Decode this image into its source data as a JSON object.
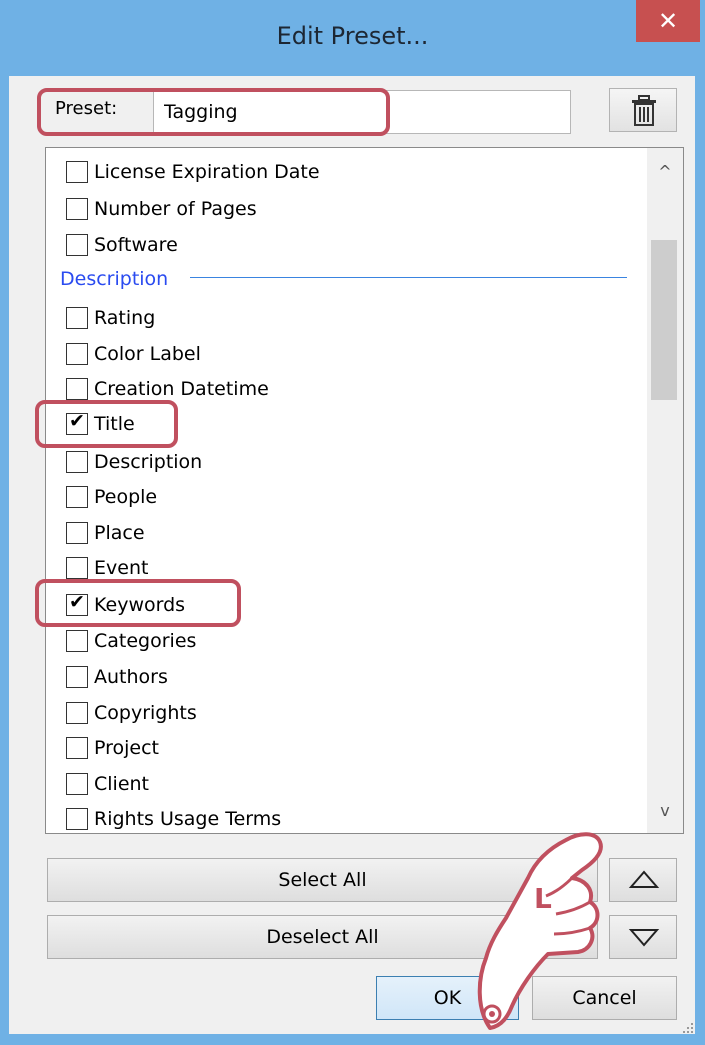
{
  "window": {
    "title": "Edit Preset...",
    "close_glyph": "✕"
  },
  "preset": {
    "label": "Preset:",
    "value": "Tagging"
  },
  "list": {
    "items_top": [
      {
        "label": "License Expiration Date",
        "checked": false
      },
      {
        "label": "Number of Pages",
        "checked": false
      },
      {
        "label": "Software",
        "checked": false
      }
    ],
    "section_label": "Description",
    "items_section": [
      {
        "label": "Rating",
        "checked": false
      },
      {
        "label": "Color Label",
        "checked": false
      },
      {
        "label": "Creation Datetime",
        "checked": false
      },
      {
        "label": "Title",
        "checked": true
      },
      {
        "label": "Description",
        "checked": false
      },
      {
        "label": "People",
        "checked": false
      },
      {
        "label": "Place",
        "checked": false
      },
      {
        "label": "Event",
        "checked": false
      },
      {
        "label": "Keywords",
        "checked": true
      },
      {
        "label": "Categories",
        "checked": false
      },
      {
        "label": "Authors",
        "checked": false
      },
      {
        "label": "Copyrights",
        "checked": false
      },
      {
        "label": "Project",
        "checked": false
      },
      {
        "label": "Client",
        "checked": false
      },
      {
        "label": "Rights Usage Terms",
        "checked": false
      }
    ],
    "scroll_up_glyph": "^",
    "scroll_down_glyph": "v"
  },
  "buttons": {
    "select_all": "Select All",
    "deselect_all": "Deselect All",
    "ok": "OK",
    "cancel": "Cancel"
  },
  "cursor": {
    "letter": "L"
  },
  "colors": {
    "titlebar": "#6fb1e5",
    "close": "#c75050",
    "highlight": "#c0505f",
    "section_text": "#2a4bf0"
  }
}
